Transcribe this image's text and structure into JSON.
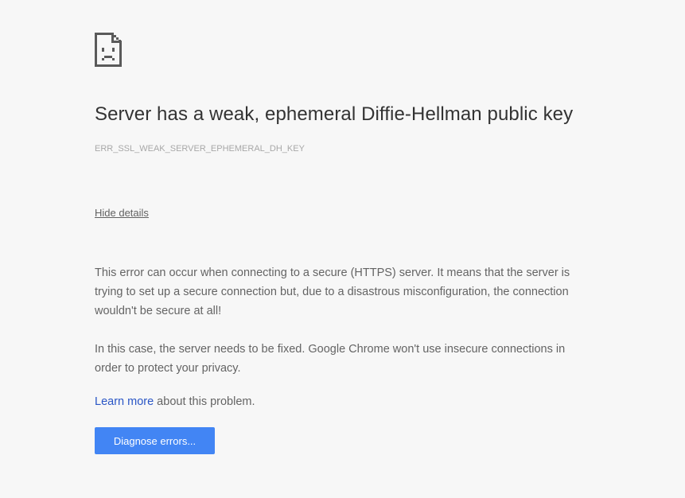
{
  "error_page": {
    "icon": "sad-page-icon",
    "title": "Server has a weak, ephemeral Diffie-Hellman public key",
    "error_code": "ERR_SSL_WEAK_SERVER_EPHEMERAL_DH_KEY",
    "details_toggle_label": "Hide details",
    "details": {
      "paragraph_1": "This error can occur when connecting to a secure (HTTPS) server. It means that the server is trying to set up a secure connection but, due to a disastrous misconfiguration, the connection wouldn't be secure at all!",
      "paragraph_2": "In this case, the server needs to be fixed. Google Chrome won't use insecure connections in order to protect your privacy.",
      "learn_more_link": "Learn more",
      "learn_more_suffix": " about this problem."
    },
    "diagnose_button_label": "Diagnose errors...",
    "colors": {
      "background": "#f7f7f7",
      "title": "#333333",
      "body_text": "#646464",
      "error_code": "#a8a8a8",
      "link": "#2a56c6",
      "button": "#4285f4"
    }
  }
}
